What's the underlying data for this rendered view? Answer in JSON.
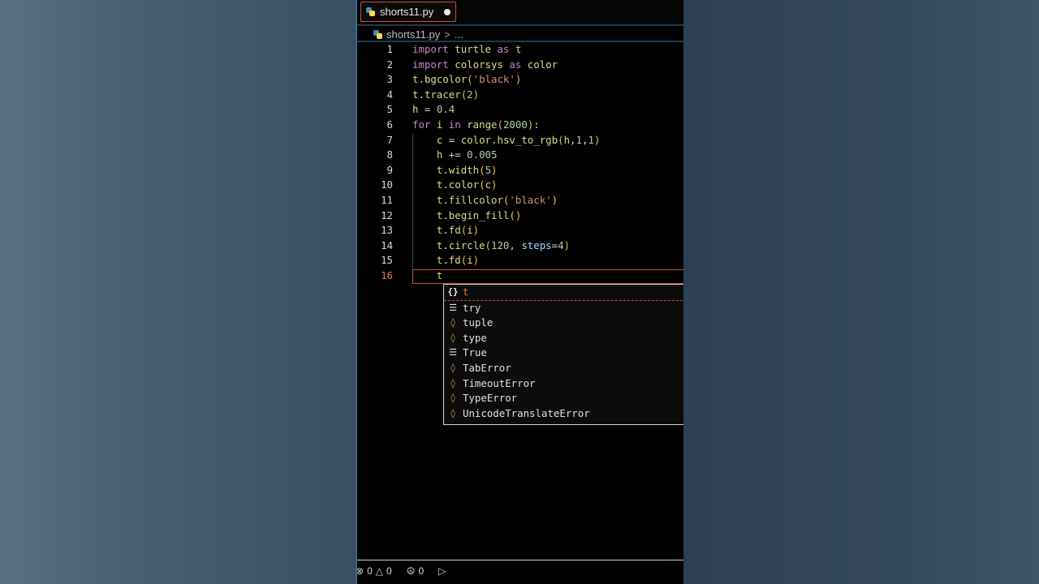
{
  "tab": {
    "filename": "shorts11.py"
  },
  "breadcrumb": {
    "file": "shorts11.py",
    "sep": ">",
    "rest": "..."
  },
  "code": {
    "line_numbers": [
      "1",
      "2",
      "3",
      "4",
      "5",
      "6",
      "7",
      "8",
      "9",
      "10",
      "11",
      "12",
      "13",
      "14",
      "15",
      "16"
    ],
    "active_line": "16"
  },
  "suggest": {
    "items": [
      {
        "icon": "module-icon",
        "label": "t"
      },
      {
        "icon": "keyword-icon",
        "label": "try"
      },
      {
        "icon": "class-icon",
        "label": "tuple"
      },
      {
        "icon": "class-icon",
        "label": "type"
      },
      {
        "icon": "keyword-icon",
        "label": "True"
      },
      {
        "icon": "class-icon",
        "label": "TabError"
      },
      {
        "icon": "class-icon",
        "label": "TimeoutError"
      },
      {
        "icon": "class-icon",
        "label": "TypeError"
      },
      {
        "icon": "class-icon",
        "label": "UnicodeTranslateError"
      }
    ]
  },
  "status": {
    "errors": "0",
    "warnings": "0",
    "ports": "0"
  },
  "colors": {
    "accent_border": "#c2503d",
    "keyword": "#c586c0",
    "string": "#ce9178",
    "number": "#b5cea8"
  }
}
